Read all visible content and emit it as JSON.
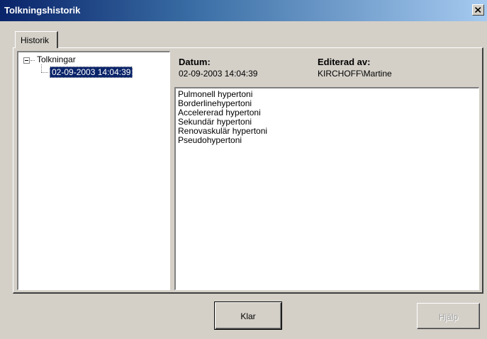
{
  "window": {
    "title": "Tolkningshistorik"
  },
  "tabs": [
    {
      "label": "Historik"
    }
  ],
  "tree": {
    "root_label": "Tolkningar",
    "expander_symbol": "minus",
    "children": [
      {
        "label": "02-09-2003 14:04:39",
        "selected": true
      }
    ]
  },
  "details": {
    "date_label": "Datum:",
    "date_value": "02-09-2003 14:04:39",
    "editor_label": "Editerad av:",
    "editor_value": "KIRCHOFF\\Martine"
  },
  "content_lines": [
    "Pulmonell hypertoni",
    "Borderlinehypertoni",
    "Accelererad hypertoni",
    "Sekundär hypertoni",
    "Renovaskulär hypertoni",
    "Pseudohypertoni"
  ],
  "buttons": {
    "ok_label": "Klar",
    "help_label": "Hjälp",
    "help_enabled": false
  },
  "colors": {
    "titlebar_start": "#0a246a",
    "titlebar_end": "#a6caf0",
    "face": "#d4d0c8",
    "selection": "#0a246a"
  },
  "icons": {
    "close": "close-icon",
    "expander": "collapse-box-icon"
  }
}
